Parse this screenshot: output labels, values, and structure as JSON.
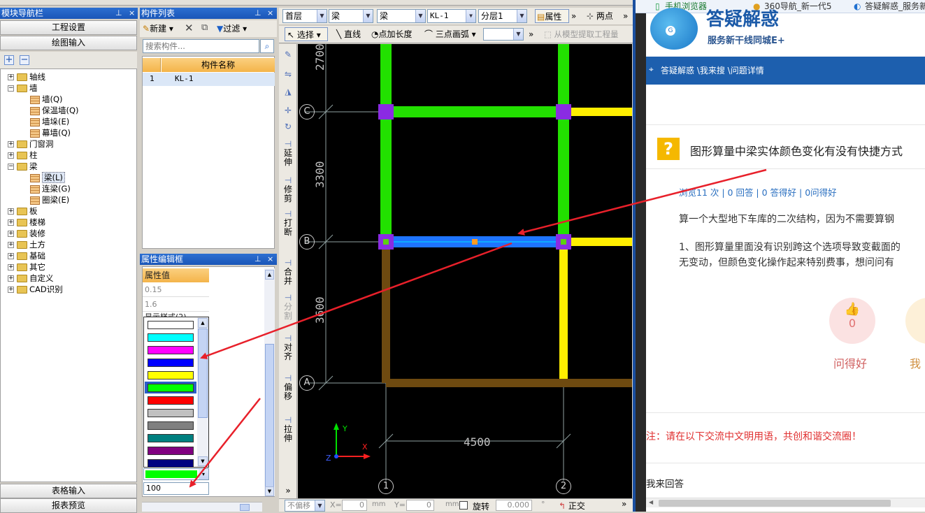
{
  "nav": {
    "title": "模块导航栏",
    "project_settings": "工程设置",
    "drawing_input": "绘图输入",
    "tree": [
      {
        "label": "轴线",
        "type": "folder",
        "level": 0,
        "expanded": false
      },
      {
        "label": "墙",
        "type": "folder",
        "level": 0,
        "expanded": true
      },
      {
        "label": "墙(Q)",
        "type": "leaf",
        "level": 1
      },
      {
        "label": "保温墙(Q)",
        "type": "leaf",
        "level": 1
      },
      {
        "label": "墙垛(E)",
        "type": "leaf",
        "level": 1
      },
      {
        "label": "幕墙(Q)",
        "type": "leaf",
        "level": 1
      },
      {
        "label": "门窗洞",
        "type": "folder",
        "level": 0,
        "expanded": false
      },
      {
        "label": "柱",
        "type": "folder",
        "level": 0,
        "expanded": false
      },
      {
        "label": "梁",
        "type": "folder",
        "level": 0,
        "expanded": true
      },
      {
        "label": "梁(L)",
        "type": "leaf",
        "level": 1,
        "selected": true
      },
      {
        "label": "连梁(G)",
        "type": "leaf",
        "level": 1
      },
      {
        "label": "圈梁(E)",
        "type": "leaf",
        "level": 1
      },
      {
        "label": "板",
        "type": "folder",
        "level": 0,
        "expanded": false
      },
      {
        "label": "楼梯",
        "type": "folder",
        "level": 0,
        "expanded": false
      },
      {
        "label": "装修",
        "type": "folder",
        "level": 0,
        "expanded": false
      },
      {
        "label": "土方",
        "type": "folder",
        "level": 0,
        "expanded": false
      },
      {
        "label": "基础",
        "type": "folder",
        "level": 0,
        "expanded": false
      },
      {
        "label": "其它",
        "type": "folder",
        "level": 0,
        "expanded": false
      },
      {
        "label": "自定义",
        "type": "folder",
        "level": 0,
        "expanded": false
      },
      {
        "label": "CAD识别",
        "type": "folder",
        "level": 0,
        "expanded": false
      }
    ],
    "table_input": "表格输入",
    "report_preview": "报表预览"
  },
  "components": {
    "title": "构件列表",
    "new_label": "新建",
    "filter_label": "过滤",
    "search_placeholder": "搜索构件...",
    "col_name": "构件名称",
    "rows": [
      {
        "index": "1",
        "name": "KL-1"
      }
    ]
  },
  "props": {
    "title": "属性编辑框",
    "col_value": "属性值",
    "values": [
      "0.15",
      "1.6",
      "显示样式(2)"
    ],
    "colors": [
      "#ffffff",
      "#00ffff",
      "#ff00ff",
      "#0000ff",
      "#ffff00",
      "#00ff00",
      "#ff0000",
      "#c0c0c0",
      "#808080",
      "#008080",
      "#800080",
      "#000080"
    ],
    "selected_color_index": 5,
    "current_color": "#00ff00",
    "transparency": "100"
  },
  "toolbar": {
    "floor": "首层",
    "type1": "梁",
    "type2": "梁",
    "component": "KL-1",
    "layer": "分层1",
    "attr_label": "属性",
    "two_point": "两点",
    "select_label": "选择",
    "line_label": "直线",
    "point_len_label": "点加长度",
    "arc_label": "三点画弧",
    "extract_label": "从模型提取工程量"
  },
  "side_tools": [
    "延伸",
    "修剪",
    "打断",
    "合并",
    "分割",
    "对齐",
    "偏移",
    "拉伸"
  ],
  "canvas": {
    "dims": {
      "top": "2700",
      "mid": "3300",
      "low": "3600",
      "bottom": "4500"
    },
    "axes": {
      "c": "C",
      "b": "B",
      "a": "A",
      "one": "1",
      "two": "2"
    },
    "ucs": {
      "y": "Y",
      "x": "X",
      "z": "Z"
    }
  },
  "status": {
    "mode": "不偏移",
    "x_label": "X=",
    "x_val": "0",
    "mm": "mm",
    "y_label": "Y=",
    "y_val": "0",
    "rotate_label": "旋转",
    "rotate_val": "0.000",
    "deg": "°",
    "ortho_label": "正交"
  },
  "browser": {
    "tabs": [
      "手机浏览器",
      "360导航_新一代5",
      "答疑解惑_服务新"
    ],
    "logo_title": "答疑解惑",
    "logo_sub": "服务新干线同城E+",
    "breadcrumb": "答疑解惑 \\我来搜 \\问题详情",
    "question_title": "图形算量中梁实体颜色变化有没有快捷方式",
    "stats": "浏览11 次 | 0 回答 | 0 答得好 | 0问得好",
    "para1": "算一个大型地下车库的二次结构，因为不需要算钢",
    "para2_line1": "1、图形算量里面没有识别跨这个选项导致变截面的",
    "para2_line2": "无变动，但颜色变化操作起来特别费事，想问问有",
    "like_count": "0",
    "ask_good": "问得好",
    "me_label": "我",
    "notice": "注：请在以下交流中文明用语，共创和谐交流圈！",
    "answer_label": "我来回答"
  }
}
